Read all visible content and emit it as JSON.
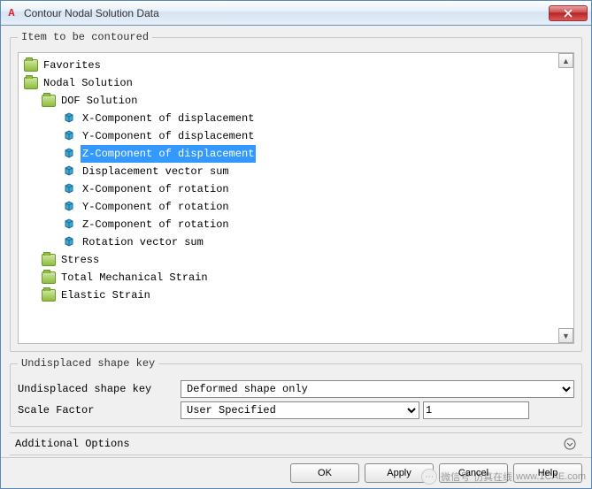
{
  "window": {
    "title": "Contour Nodal Solution Data",
    "app_icon_letter": "A"
  },
  "tree": {
    "legend": "Item to be contoured",
    "favorites": "Favorites",
    "nodal_solution": "Nodal Solution",
    "dof_solution": "DOF Solution",
    "items": [
      "X-Component of displacement",
      "Y-Component of displacement",
      "Z-Component of displacement",
      "Displacement vector sum",
      "X-Component of rotation",
      "Y-Component of rotation",
      "Z-Component of rotation",
      "Rotation vector sum"
    ],
    "selected_index": 2,
    "stress": "Stress",
    "total_mech_strain": "Total Mechanical Strain",
    "elastic_strain": "Elastic Strain"
  },
  "shape": {
    "legend": "Undisplaced shape key",
    "key_label": "Undisplaced shape key",
    "key_value": "Deformed shape only",
    "scale_label": "Scale Factor",
    "scale_mode": "User Specified",
    "scale_value": "1"
  },
  "additional": {
    "label": "Additional Options"
  },
  "buttons": {
    "ok": "OK",
    "apply": "Apply",
    "cancel": "Cancel",
    "help": "Help"
  },
  "watermark": {
    "text1": "微信号",
    "text2": "仿真在线",
    "url": "www.1CAE.com"
  }
}
